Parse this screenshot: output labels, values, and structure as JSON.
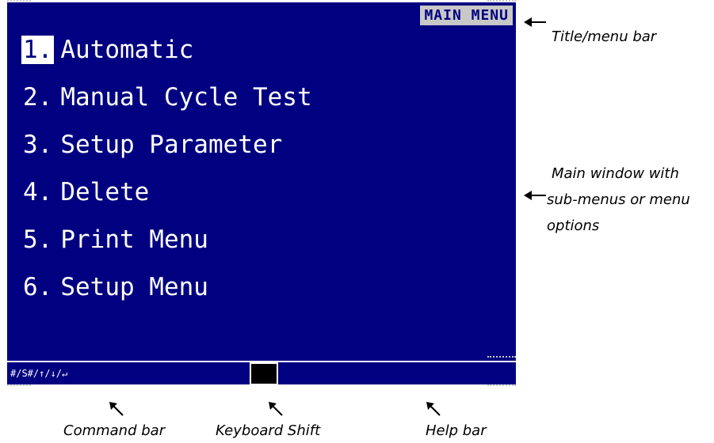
{
  "screen": {
    "title": "MAIN MENU",
    "menu_items": [
      {
        "num": "1.",
        "label": "Automatic"
      },
      {
        "num": "2.",
        "label": "Manual Cycle Test"
      },
      {
        "num": "3.",
        "label": "Setup Parameter"
      },
      {
        "num": "4.",
        "label": "Delete"
      },
      {
        "num": "5.",
        "label": "Print Menu"
      },
      {
        "num": "6.",
        "label": "Setup Menu"
      }
    ],
    "command_bar": "#/S#/↑/↓/↵",
    "selected_index": 0
  },
  "annotations": {
    "title_bar": "Title/menu bar",
    "main_window": [
      "Main window with",
      "sub-menus or menu",
      "options"
    ],
    "command_bar": "Command bar",
    "keyboard_shift": "Keyboard Shift",
    "help_bar": "Help bar"
  },
  "colors": {
    "screen_bg": "#000080",
    "title_bg": "#c8c8c8",
    "text": "#ffffff"
  }
}
